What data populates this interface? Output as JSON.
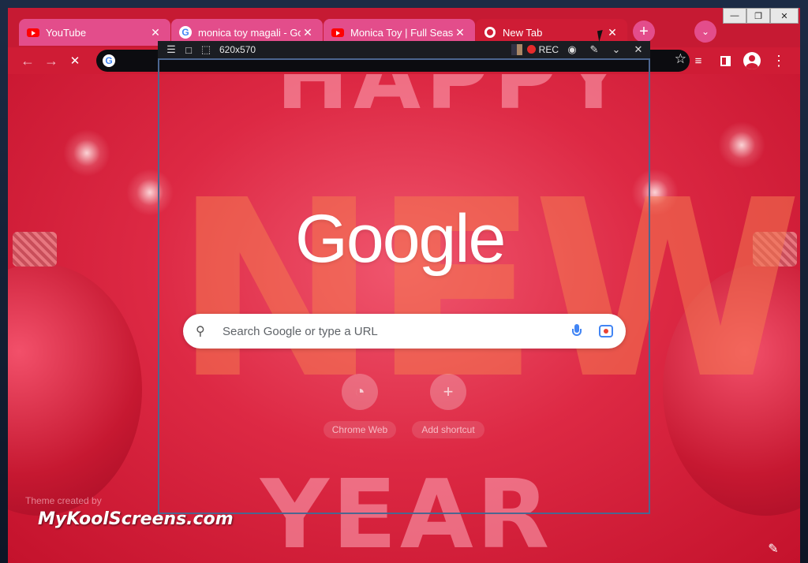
{
  "tabs": [
    {
      "title": "YouTube",
      "favicon": "youtube-icon"
    },
    {
      "title": "monica toy magali - Goo",
      "favicon": "google-icon"
    },
    {
      "title": "Monica Toy | Full Season",
      "favicon": "youtube-icon"
    },
    {
      "title": "New Tab",
      "favicon": "chrome-icon",
      "active": true
    }
  ],
  "tab_close_glyph": "✕",
  "new_tab_glyph": "+",
  "tab_search_glyph": "⌄",
  "window_controls": {
    "minimize": "—",
    "maximize": "❐",
    "close": "✕"
  },
  "toolbar": {
    "back": "←",
    "forward": "→",
    "stop": "✕",
    "star": "☆",
    "menu": "⋮",
    "omnibox_g": "G"
  },
  "recorder": {
    "dimensions": "620x570",
    "rec_label": "REC",
    "menu_glyph": "☰",
    "region_glyph": "□"
  },
  "ntp": {
    "logo": "Google",
    "search_placeholder": "Search Google or type a URL",
    "shortcuts": [
      {
        "label": "Chrome Web",
        "glyph": "◔"
      },
      {
        "label": "Add shortcut",
        "glyph": "+"
      }
    ],
    "theme_credit": "Theme created by",
    "edit_glyph": "✎"
  },
  "theme_text": {
    "top": "HAPPY",
    "middle": "NEW",
    "bottom": "YEAR"
  },
  "watermark": "MyKoolScreens.com",
  "colors": {
    "theme_red": "#d8223e",
    "tab_pink": "#e34d8b",
    "rec_red": "#e62b2b"
  }
}
